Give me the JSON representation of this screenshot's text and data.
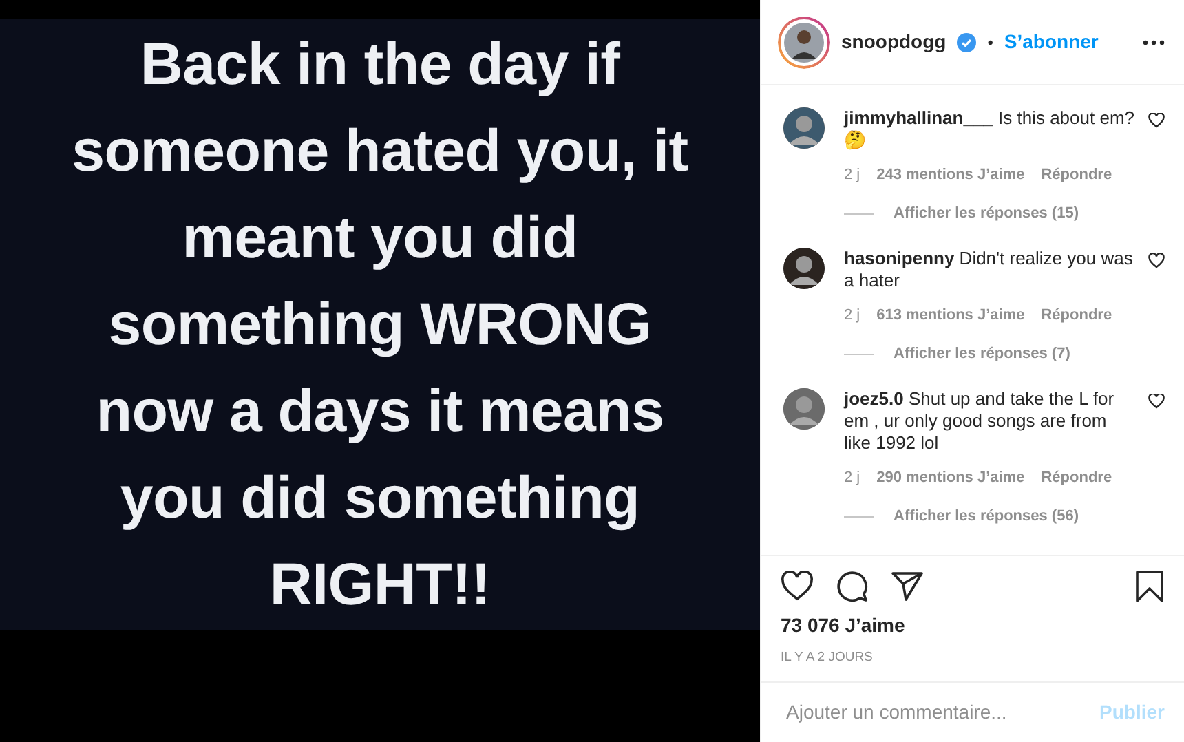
{
  "post_image": {
    "lines": [
      "Back in the day if",
      "someone hated you, it",
      "meant you did",
      "something WRONG",
      "now a days it means",
      "you did something",
      "RIGHT!!"
    ]
  },
  "header": {
    "username": "snoopdogg",
    "verified": true,
    "separator": "•",
    "follow": "S’abonner"
  },
  "comments": [
    {
      "username": "jimmyhallinan___",
      "text": "Is this about em?",
      "emoji": "🤔",
      "time": "2 j",
      "likes": "243 mentions J’aime",
      "reply": "Répondre",
      "replies": "Afficher les réponses (15)"
    },
    {
      "username": "hasonipenny",
      "text": "Didn't realize you was a hater",
      "time": "2 j",
      "likes": "613 mentions J’aime",
      "reply": "Répondre",
      "replies": "Afficher les réponses (7)"
    },
    {
      "username": "joez5.0",
      "text": "Shut up and take the L for em , ur only good songs are from like 1992 lol",
      "time": "2 j",
      "likes": "290 mentions J’aime",
      "reply": "Répondre",
      "replies": "Afficher les réponses (56)"
    }
  ],
  "likes": "73 076 J’aime",
  "date": "IL Y A 2 JOURS",
  "comment_box": {
    "placeholder": "Ajouter un commentaire...",
    "submit": "Publier",
    "disabled": true
  }
}
